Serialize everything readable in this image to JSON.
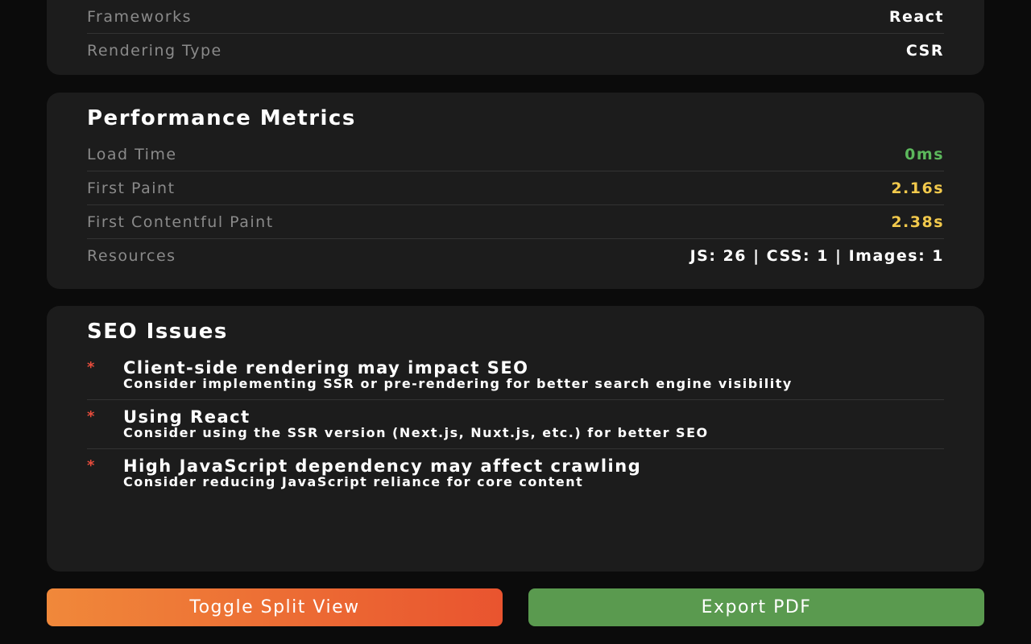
{
  "frameworks_card": {
    "rows": [
      {
        "label": "Frameworks",
        "value": "React"
      },
      {
        "label": "Rendering Type",
        "value": "CSR"
      }
    ]
  },
  "performance": {
    "title": "Performance Metrics",
    "rows": [
      {
        "label": "Load Time",
        "value": "0ms",
        "color": "#5cb85c"
      },
      {
        "label": "First Paint",
        "value": "2.16s",
        "color": "#f2c94c"
      },
      {
        "label": "First Contentful Paint",
        "value": "2.38s",
        "color": "#f2c94c"
      },
      {
        "label": "Resources",
        "value": "JS: 26 | CSS: 1 | Images: 1",
        "color": "#ffffff"
      }
    ]
  },
  "seo": {
    "title": "SEO Issues",
    "bullet": "*",
    "issues": [
      {
        "title": "Client-side rendering may impact SEO",
        "description": "Consider implementing SSR or pre-rendering for better search engine visibility"
      },
      {
        "title": "Using React",
        "description": "Consider using the SSR version (Next.js, Nuxt.js, etc.) for better SEO"
      },
      {
        "title": "High JavaScript dependency may affect crawling",
        "description": "Consider reducing JavaScript reliance for core content"
      }
    ]
  },
  "actions": {
    "toggle_label": "Toggle Split View",
    "export_label": "Export PDF"
  },
  "colors": {
    "background": "#0b0b0b",
    "card": "#1c1c1c",
    "good": "#5cb85c",
    "warning": "#f2c94c",
    "issue_bullet": "#e74c3c",
    "export_button": "#5a9a4f",
    "toggle_gradient_start": "#f0883a",
    "toggle_gradient_end": "#e9542f"
  }
}
